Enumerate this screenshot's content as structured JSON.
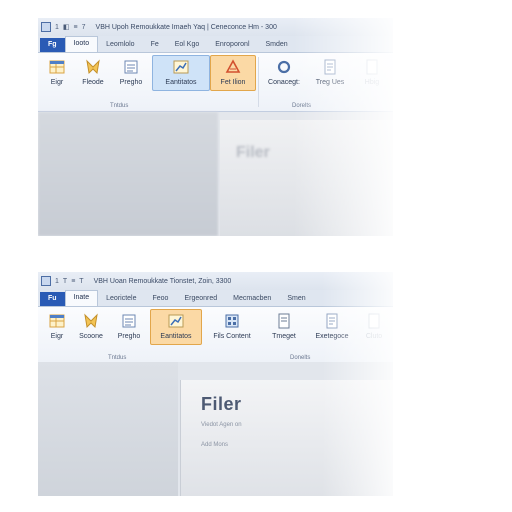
{
  "shot1": {
    "title": "VBH Upoh Remoukkate Imaeh Yaq | Ceneconce Hm - 300",
    "qat": [
      "1",
      "◧",
      "≡",
      "7"
    ],
    "tabs": [
      "Fg",
      "Iooto",
      "Leomlolo",
      "Fe",
      "Eol Kgo",
      "Enroporonl",
      "Smden"
    ],
    "buttons": [
      "Eigr",
      "Fleode",
      "Pregho",
      "Eantitatos",
      "Fet Ilion",
      "Conacegt:",
      "Treg Ues",
      "Hbig"
    ],
    "group_labels": [
      "Tntdus",
      "Dorelts"
    ],
    "ghost_text": "Filer"
  },
  "shot2": {
    "title": "VBH Uoan Remoukkate Tionstet, Zoin, 3300",
    "qat": [
      "1",
      "T",
      "≡",
      "T"
    ],
    "tabs": [
      "Fu",
      "Inate",
      "Leorictele",
      "Feoo",
      "Ergeonred",
      "Mecmacben",
      "Smen"
    ],
    "buttons": [
      "Eigr",
      "Scoone",
      "Pregho",
      "Eantitatos",
      "Fils Content",
      "Tmeget",
      "Exetegoce",
      "Cluto"
    ],
    "group_labels": [
      "Tntdus",
      "Donelts"
    ],
    "heading": "Filer",
    "line1": "Viedot Agen on",
    "line2": "Add Mons"
  },
  "colors": {
    "file_tab": "#2a5bb5",
    "highlight_blue": "#cfe3f8",
    "highlight_orange": "#fbd9a5"
  },
  "icons": [
    "app-icon",
    "table-icon",
    "bookmark-icon",
    "grid-icon",
    "chart-icon",
    "triangle-icon",
    "ring-icon",
    "document-icon"
  ]
}
